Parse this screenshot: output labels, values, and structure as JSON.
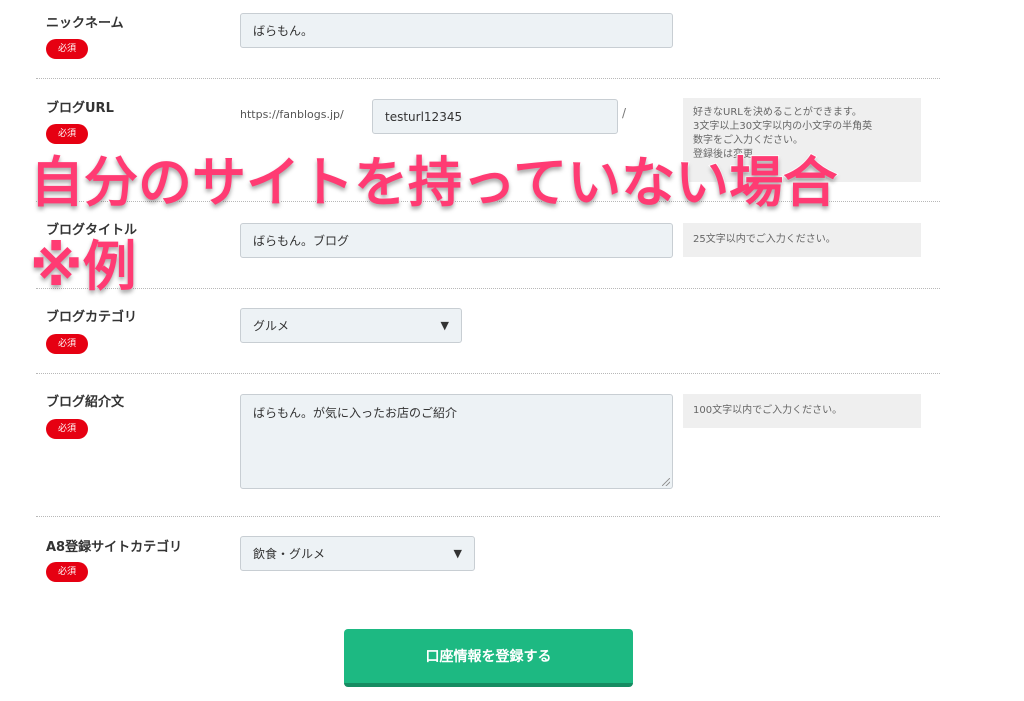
{
  "required_label": "必須",
  "nickname": {
    "label": "ニックネーム",
    "value": "ばらもん。"
  },
  "blog_url": {
    "label": "ブログURL",
    "prefix": "https://fanblogs.jp/",
    "value": "testurl12345",
    "suffix": "/",
    "help_lines": [
      "好きなURLを決めることができます。",
      "3文字以上30文字以内の小文字の半角英",
      "数字をご入力ください。",
      "登録後は変更"
    ]
  },
  "blog_title": {
    "label": "ブログタイトル",
    "value": "ばらもん。ブログ",
    "help": "25文字以内でご入力ください。"
  },
  "blog_category": {
    "label": "ブログカテゴリ",
    "value": "グルメ",
    "arrow": "▼"
  },
  "blog_intro": {
    "label": "ブログ紹介文",
    "value": "ばらもん。が気に入ったお店のご紹介",
    "help": "100文字以内でご入力ください。"
  },
  "a8_category": {
    "label": "A8登録サイトカテゴリ",
    "value": "飲食・グルメ",
    "arrow": "▼"
  },
  "submit_label": "口座情報を登録する",
  "overlay": {
    "line1": "自分のサイトを持っていない場合",
    "line2": "※例",
    "color": "#ff3b73"
  },
  "colors": {
    "badge": "#e60012",
    "button": "#1db982"
  }
}
